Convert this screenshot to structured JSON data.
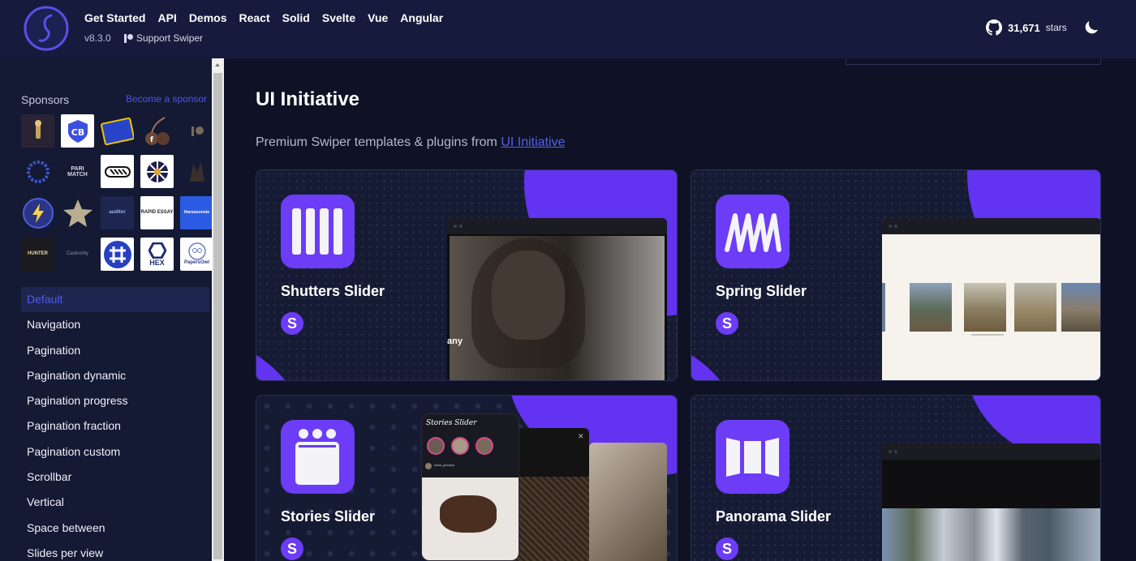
{
  "header": {
    "nav": [
      "Get Started",
      "API",
      "Demos",
      "React",
      "Solid",
      "Svelte",
      "Vue",
      "Angular"
    ],
    "version": "v8.3.0",
    "support_label": "Support Swiper",
    "github_stars": "31,671",
    "stars_label": "stars"
  },
  "sidebar": {
    "sponsors_title": "Sponsors",
    "become_sponsor": "Become a sponsor",
    "sponsor_texts": {
      "parimatch": "PARI MATCH",
      "auditor": "auditor",
      "rapid_essay": "RAPID ESSAY",
      "thereasoners": "thereasonsto",
      "hunter": "HUNTER",
      "casinority": "Casinority",
      "hex": "HEX",
      "papersowl": "PapersOwl"
    },
    "items": [
      "Default",
      "Navigation",
      "Pagination",
      "Pagination dynamic",
      "Pagination progress",
      "Pagination fraction",
      "Pagination custom",
      "Scrollbar",
      "Vertical",
      "Space between",
      "Slides per view"
    ],
    "active_index": 0
  },
  "main": {
    "title": "UI Initiative",
    "subtitle_prefix": "Premium Swiper templates & plugins from ",
    "subtitle_link": "UI Initiative",
    "cards": [
      {
        "title": "Shutters Slider",
        "badge": "S",
        "preview_text": "any"
      },
      {
        "title": "Spring Slider",
        "badge": "S"
      },
      {
        "title": "Stories Slider",
        "badge": "S",
        "preview_title": "Stories Slider",
        "preview_user": "mark_johnson"
      },
      {
        "title": "Panorama Slider",
        "badge": "S"
      }
    ]
  },
  "colors": {
    "accent": "#6c3cf7",
    "link": "#4d57e8",
    "header_bg": "#161b3d",
    "page_bg": "#0f1224"
  },
  "icons": [
    "swiper-logo-icon",
    "patreon-icon",
    "github-icon",
    "moon-icon",
    "shutters-icon",
    "spring-icon",
    "stories-icon",
    "panorama-icon"
  ]
}
